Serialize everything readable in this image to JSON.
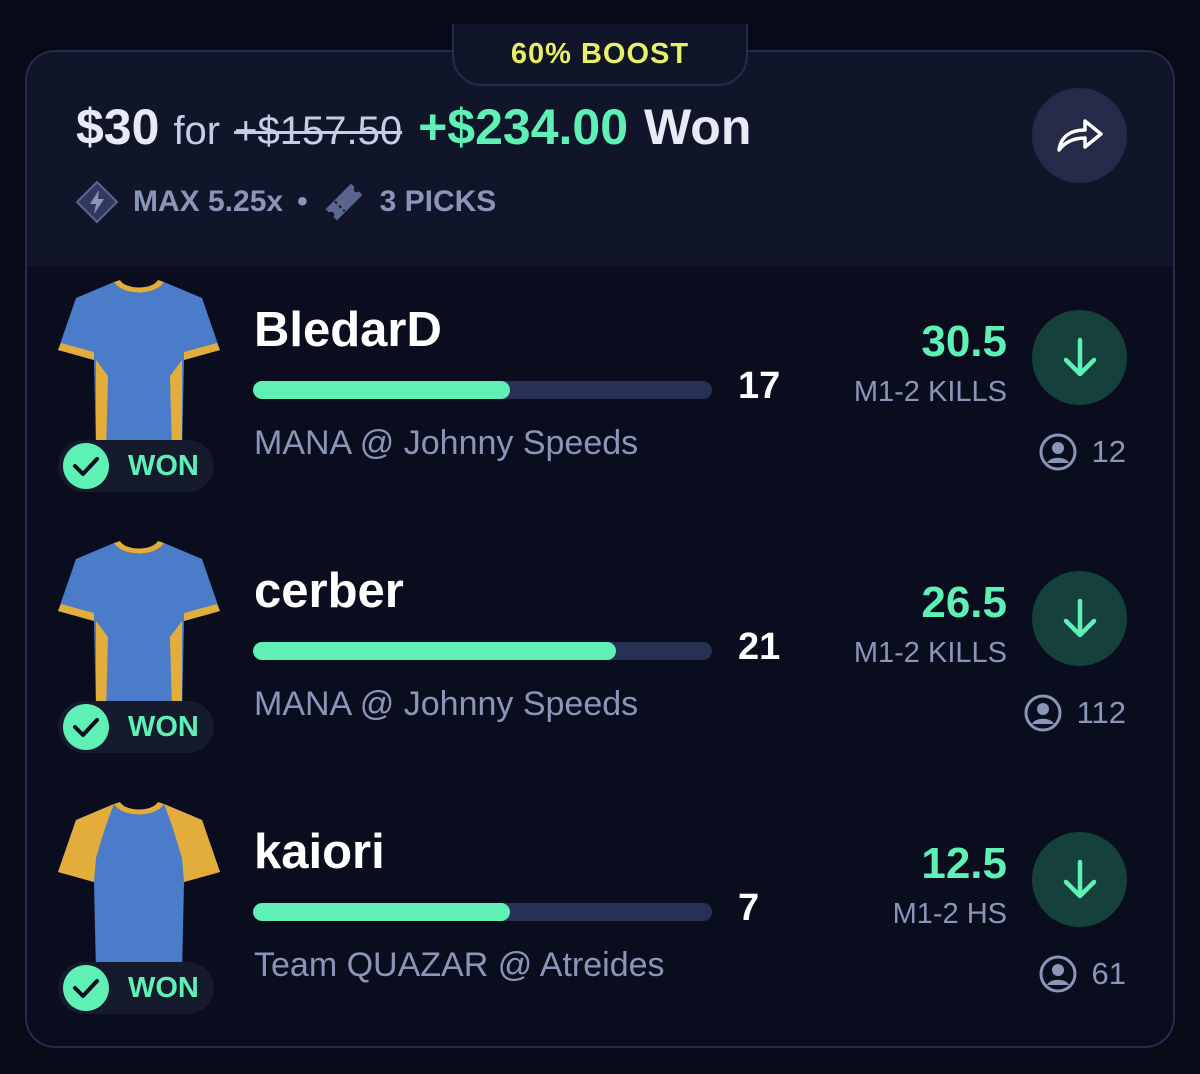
{
  "entry": {
    "boost_label": "60% BOOST",
    "stake": "$30",
    "for_label": "for",
    "original_payout": "+$157.50",
    "won_amount": "+$234.00",
    "won_label": "Won",
    "max_multiplier": "MAX 5.25x",
    "separator": "•",
    "picks_count": "3 PICKS",
    "share_icon": "share-arrow-icon"
  },
  "colors": {
    "accent_green": "#5ff0b6",
    "boost_yellow": "#e8f064",
    "background": "#080a17",
    "muted_text": "#8a95b8"
  },
  "picks": [
    {
      "player": "BledarD",
      "actual": "17",
      "progress": 0.56,
      "matchup": "MANA @ Johnny Speeds",
      "line": "30.5",
      "stat": "M1-2 KILLS",
      "direction": "under",
      "users": "12",
      "status": "WON",
      "jersey": "blue-yellow-trim"
    },
    {
      "player": "cerber",
      "actual": "21",
      "progress": 0.79,
      "matchup": "MANA @ Johnny Speeds",
      "line": "26.5",
      "stat": "M1-2 KILLS",
      "direction": "under",
      "users": "112",
      "status": "WON",
      "jersey": "blue-yellow-trim"
    },
    {
      "player": "kaiori",
      "actual": "7",
      "progress": 0.56,
      "matchup": "Team QUAZAR @ Atreides",
      "line": "12.5",
      "stat": "M1-2 HS",
      "direction": "under",
      "users": "61",
      "status": "WON",
      "jersey": "blue-yellow-sleeves"
    }
  ]
}
